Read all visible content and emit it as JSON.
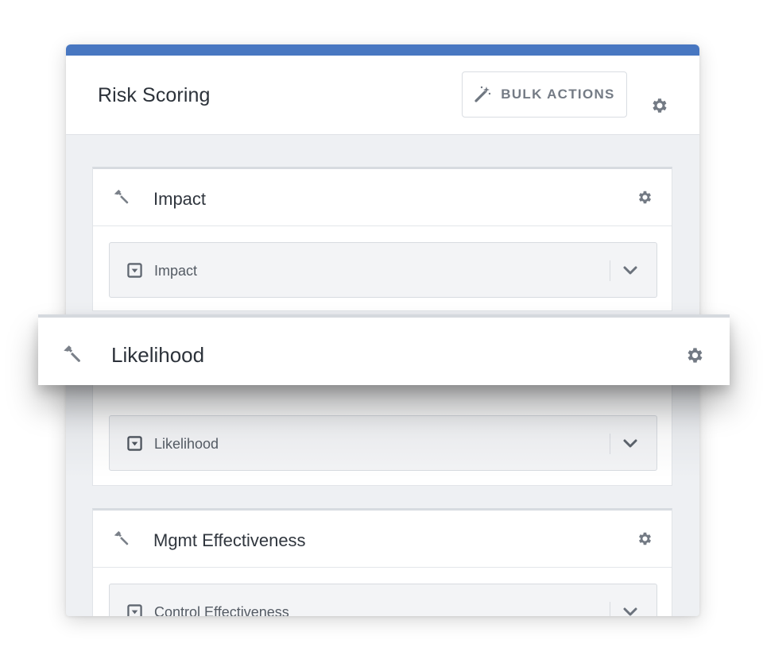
{
  "header": {
    "title": "Risk Scoring",
    "bulk_actions_label": "BULK ACTIONS"
  },
  "cards": [
    {
      "title": "Impact",
      "select_value": "Impact"
    },
    {
      "title": "Likelihood",
      "select_value": "Likelihood"
    },
    {
      "title": "Mgmt Effectiveness",
      "select_value": "Control Effectiveness"
    }
  ],
  "dragging": {
    "title": "Likelihood"
  },
  "colors": {
    "accent": "#4877c1",
    "icon": "#7a8089",
    "text": "#2c323a"
  },
  "icons": {
    "bulk_actions": "magic-wand-icon",
    "settings": "gear-icon",
    "row_handle": "hammer-icon",
    "select_type": "dropdown-square-icon",
    "expand": "chevron-down-icon"
  }
}
